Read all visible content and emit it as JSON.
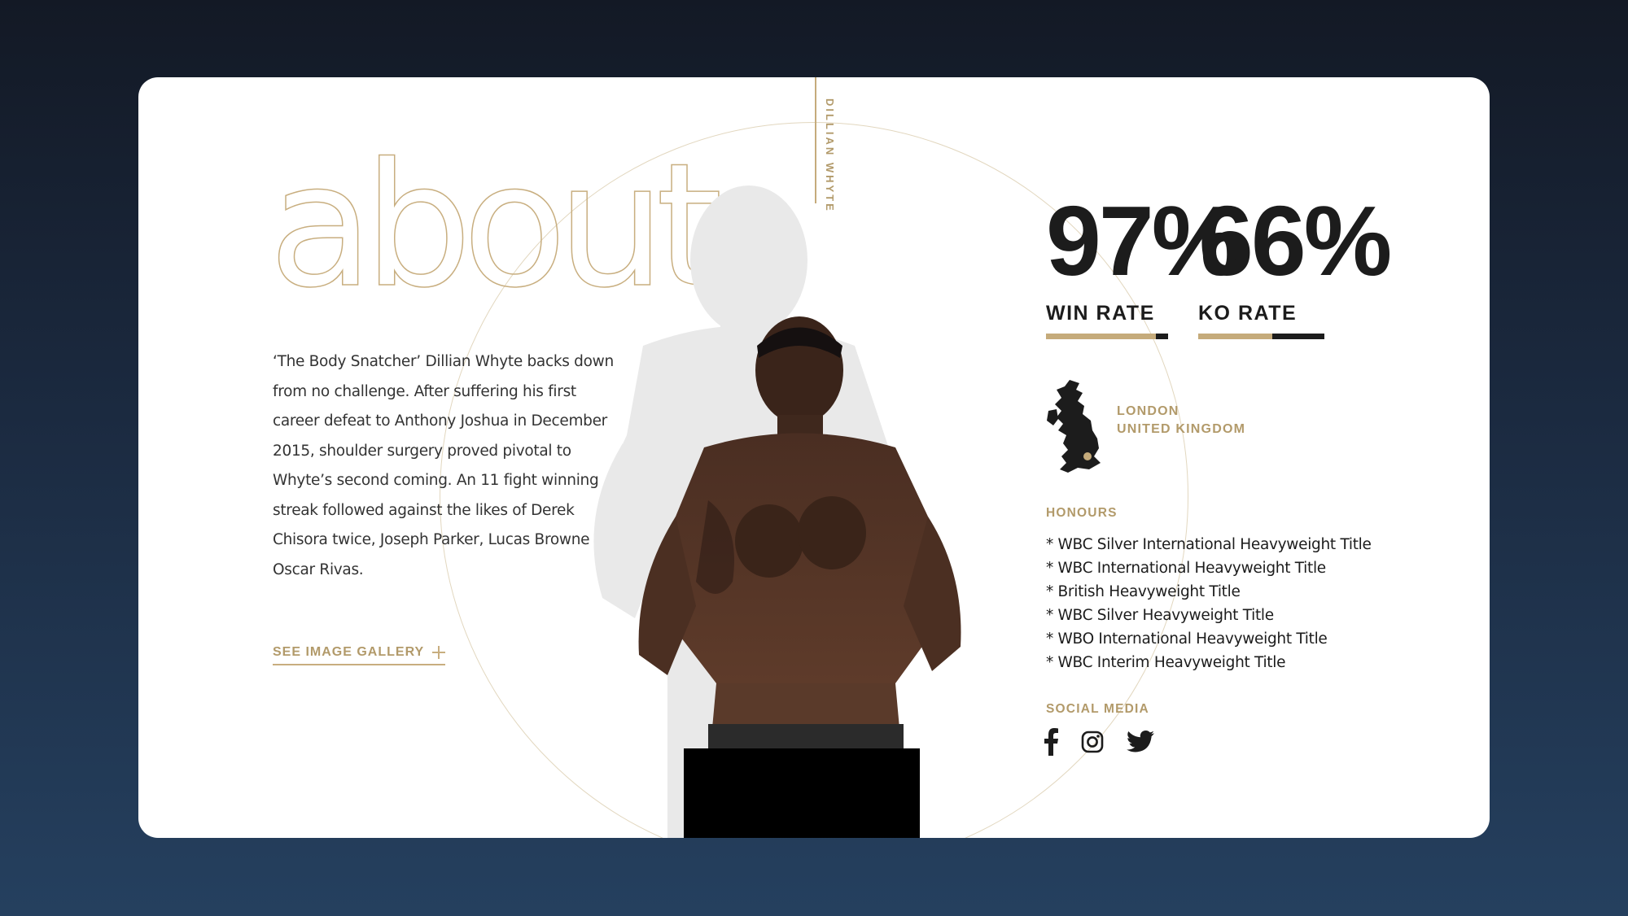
{
  "header": {
    "vertical_name": "DILLIAN WHYTE"
  },
  "about": {
    "heading": "about",
    "bio": "‘The Body Snatcher’ Dillian Whyte backs down from no challenge. After suffering his first career defeat to Anthony Joshua in December 2015, shoulder surgery proved pivotal to Whyte’s second coming. An 11 fight winning streak followed against the likes of Derek Chisora twice, Joseph Parker, Lucas Browne and Oscar Rivas.",
    "gallery_link": "SEE IMAGE GALLERY"
  },
  "stats": [
    {
      "value": "97%",
      "label": "WIN RATE",
      "percent": 97
    },
    {
      "value": "66%",
      "label": "KO RATE",
      "percent": 66
    }
  ],
  "location": {
    "city": "LONDON",
    "country": "UNITED KINGDOM",
    "map_icon": "uk-map-icon"
  },
  "honours": {
    "label": "HONOURS",
    "items": [
      "* WBC Silver International Heavyweight Title",
      "* WBC International Heavyweight Title",
      "* British Heavyweight Title",
      "* WBC Silver Heavyweight Title",
      "* WBO International Heavyweight Title",
      "* WBC Interim Heavyweight Title"
    ]
  },
  "social": {
    "label": "SOCIAL MEDIA",
    "icons": [
      "facebook-icon",
      "instagram-icon",
      "twitter-icon"
    ]
  },
  "colors": {
    "page_bg_top": "#131925",
    "page_bg_bottom": "#25405f",
    "card_bg": "#ffffff",
    "gold": "#c5ab7b",
    "gold_text": "#b29a6a",
    "dark": "#1c1c1c"
  }
}
